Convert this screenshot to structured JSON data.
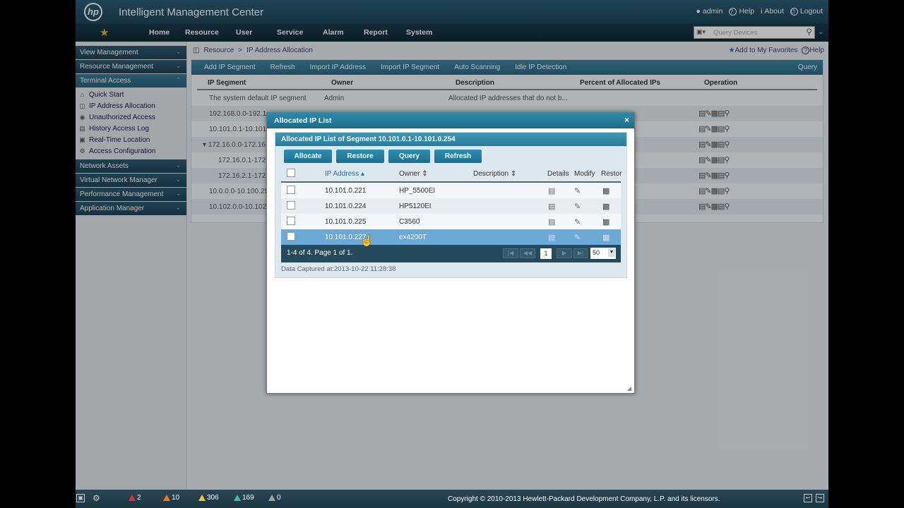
{
  "header": {
    "logo": "hp",
    "title": "Intelligent Management Center",
    "user": "admin",
    "help": "Help",
    "about": "About",
    "logout": "Logout"
  },
  "menu": {
    "items": [
      "Home",
      "Resource",
      "User",
      "Service",
      "Alarm",
      "Report",
      "System"
    ],
    "search_placeholder": "Query Devices"
  },
  "sidebar": {
    "sections": [
      {
        "label": "View Management"
      },
      {
        "label": "Resource Management"
      },
      {
        "label": "Terminal Access"
      }
    ],
    "terminal_items": [
      {
        "label": "Quick Start",
        "icon": "home-icon"
      },
      {
        "label": "IP Address Allocation",
        "icon": "network-icon"
      },
      {
        "label": "Unauthorized Access",
        "icon": "user-warning-icon"
      },
      {
        "label": "History Access Log",
        "icon": "log-icon"
      },
      {
        "label": "Real-Time Location",
        "icon": "location-icon"
      },
      {
        "label": "Access Configuration",
        "icon": "config-icon"
      }
    ],
    "bottom_sections": [
      {
        "label": "Network Assets"
      },
      {
        "label": "Virtual Network Manager"
      },
      {
        "label": "Performance Management"
      },
      {
        "label": "Application Manager"
      }
    ]
  },
  "breadcrumb": {
    "root": "Resource",
    "sep": ">",
    "current": "IP Address Allocation",
    "favorites": "Add to My Favorites",
    "help": "Help"
  },
  "toolbar": {
    "items": [
      "Add IP Segment",
      "Refresh",
      "Import IP Address",
      "Import IP Segment",
      "Auto Scanning",
      "Idle IP Detection"
    ],
    "query": "Query"
  },
  "main_table": {
    "headers": [
      "IP Segment",
      "Owner",
      "Description",
      "Percent of Allocated IPs",
      "Operation"
    ],
    "rows": [
      {
        "segment": "The system default IP segment",
        "owner": "Admin",
        "description": "Allocated IP addresses that do not b..."
      },
      {
        "segment": "192.168.0.0-192.1",
        "owner": "",
        "description": ""
      },
      {
        "segment": "10.101.0.1-10.101",
        "owner": "",
        "description": ""
      },
      {
        "segment": "▾ 172.16.0.0-172.16",
        "owner": "",
        "description": ""
      },
      {
        "segment": "172.16.0.1-172.",
        "owner": "",
        "description": ""
      },
      {
        "segment": "172.16.2.1-172.",
        "owner": "",
        "description": ""
      },
      {
        "segment": "10.0.0.0-10.100.25",
        "owner": "",
        "description": ""
      },
      {
        "segment": "10.102.0.0-10.102",
        "owner": "",
        "description": ""
      }
    ]
  },
  "modal": {
    "title": "Allocated IP List",
    "close": "×",
    "subtitle": "Allocated IP List of Segment 10.101.0.1-10.101.0.254",
    "buttons": [
      "Allocate",
      "Restore",
      "Query",
      "Refresh"
    ],
    "headers": {
      "ip": "IP Address",
      "owner": "Owner",
      "description": "Description",
      "details": "Details",
      "modify": "Modify",
      "restore": "Restore"
    },
    "rows": [
      {
        "ip": "10.101.0.221",
        "owner": "HP_5500EI",
        "description": ""
      },
      {
        "ip": "10.101.0.224",
        "owner": "HP5120EI",
        "description": ""
      },
      {
        "ip": "10.101.0.225",
        "owner": "C3560",
        "description": ""
      },
      {
        "ip": "10.101.0.227",
        "owner": "ex4200T",
        "description": ""
      }
    ],
    "pager": {
      "summary": "1-4 of 4. Page 1 of 1.",
      "current_page": "1",
      "page_size": "50"
    },
    "captured": "Data Captured at:2013-10-22 11:28:38"
  },
  "statusbar": {
    "alarms": [
      {
        "count": "2",
        "color": "#d9302b"
      },
      {
        "count": "10",
        "color": "#f07b1a"
      },
      {
        "count": "306",
        "color": "#f3c425"
      },
      {
        "count": "169",
        "color": "#3bbfb2"
      },
      {
        "count": "0",
        "color": "#9aa3a8"
      }
    ],
    "copyright": "Copyright © 2010-2013 Hewlett-Packard Development Company, L.P. and its licensors."
  }
}
